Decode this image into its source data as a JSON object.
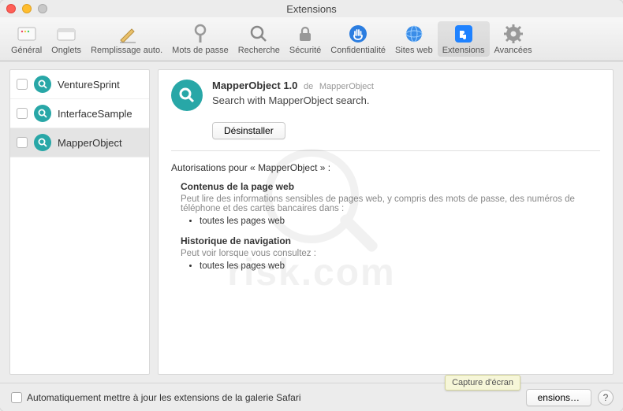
{
  "window": {
    "title": "Extensions"
  },
  "toolbar": {
    "items": [
      {
        "label": "Général"
      },
      {
        "label": "Onglets"
      },
      {
        "label": "Remplissage auto."
      },
      {
        "label": "Mots de passe"
      },
      {
        "label": "Recherche"
      },
      {
        "label": "Sécurité"
      },
      {
        "label": "Confidentialité"
      },
      {
        "label": "Sites web"
      },
      {
        "label": "Extensions"
      },
      {
        "label": "Avancées"
      }
    ],
    "selected_index": 8
  },
  "sidebar": {
    "items": [
      {
        "label": "VentureSprint"
      },
      {
        "label": "InterfaceSample"
      },
      {
        "label": "MapperObject"
      }
    ],
    "selected_index": 2
  },
  "detail": {
    "name": "MapperObject",
    "version": "1.0",
    "by_prefix": "de",
    "author": "MapperObject",
    "description": "Search with MapperObject search.",
    "uninstall_label": "Désinstaller",
    "permissions_heading": "Autorisations pour « MapperObject » :",
    "sections": [
      {
        "title": "Contenus de la page web",
        "desc": "Peut lire des informations sensibles de pages web, y compris des mots de passe, des numéros de téléphone et des cartes bancaires dans :",
        "bullets": [
          "toutes les pages web"
        ]
      },
      {
        "title": "Historique de navigation",
        "desc": "Peut voir lorsque vous consultez :",
        "bullets": [
          "toutes les pages web"
        ]
      }
    ]
  },
  "footer": {
    "auto_update_label": "Automatiquement mettre à jour les extensions de la galerie Safari",
    "more_button": "ensions…",
    "tooltip": "Capture d'écran",
    "help": "?"
  },
  "icons": {
    "general": "general-icon",
    "tabs": "tabs-icon",
    "autofill": "autofill-pencil-icon",
    "passwords": "key-icon",
    "search": "magnifier-icon",
    "security": "lock-icon",
    "privacy": "hand-icon",
    "websites": "globe-icon",
    "extensions": "puzzle-icon",
    "advanced": "gear-icon"
  },
  "colors": {
    "accent": "#28a7a7",
    "selected_bg": "#e4e4e4",
    "ext_tab_blue": "#1f82ff"
  },
  "watermark": {
    "text": "risk.com"
  }
}
